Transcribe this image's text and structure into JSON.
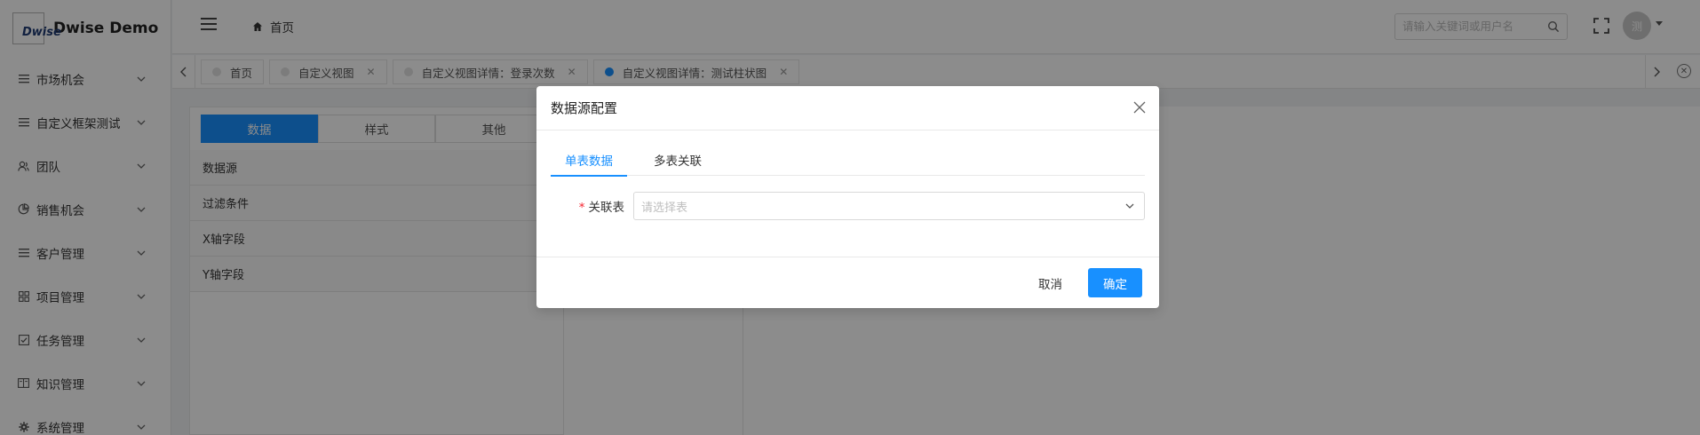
{
  "app": {
    "logo_mark": "Dwise",
    "logo_text": "Dwise Demo"
  },
  "sidebar": {
    "items": [
      {
        "label": "市场机会",
        "icon": "list-icon"
      },
      {
        "label": "自定义框架测试",
        "icon": "list-icon"
      },
      {
        "label": "团队",
        "icon": "team-icon"
      },
      {
        "label": "销售机会",
        "icon": "pie-icon"
      },
      {
        "label": "客户管理",
        "icon": "list-icon"
      },
      {
        "label": "项目管理",
        "icon": "grid-icon"
      },
      {
        "label": "任务管理",
        "icon": "checkbox-icon"
      },
      {
        "label": "知识管理",
        "icon": "book-icon"
      },
      {
        "label": "系统管理",
        "icon": "gear-icon"
      }
    ]
  },
  "header": {
    "breadcrumb": "首页",
    "search_placeholder": "请输入关键词或用户名",
    "avatar_text": "测"
  },
  "tabs": [
    {
      "label": "首页",
      "closable": false,
      "active": false
    },
    {
      "label": "自定义视图",
      "closable": true,
      "active": false
    },
    {
      "label": "自定义视图详情：登录次数",
      "closable": true,
      "active": false
    },
    {
      "label": "自定义视图详情：测试柱状图",
      "closable": true,
      "active": true
    }
  ],
  "config": {
    "segments": [
      "数据",
      "样式",
      "其他"
    ],
    "rows": [
      "数据源",
      "过滤条件",
      "X轴字段",
      "Y轴字段"
    ]
  },
  "modal": {
    "title": "数据源配置",
    "tabs": [
      "单表数据",
      "多表关联"
    ],
    "field_label": "关联表",
    "field_placeholder": "请选择表",
    "cancel_label": "取消",
    "ok_label": "确定"
  },
  "colors": {
    "primary": "#1890ff",
    "required": "#f5222d",
    "overlay": "rgba(0,0,0,0.45)"
  }
}
